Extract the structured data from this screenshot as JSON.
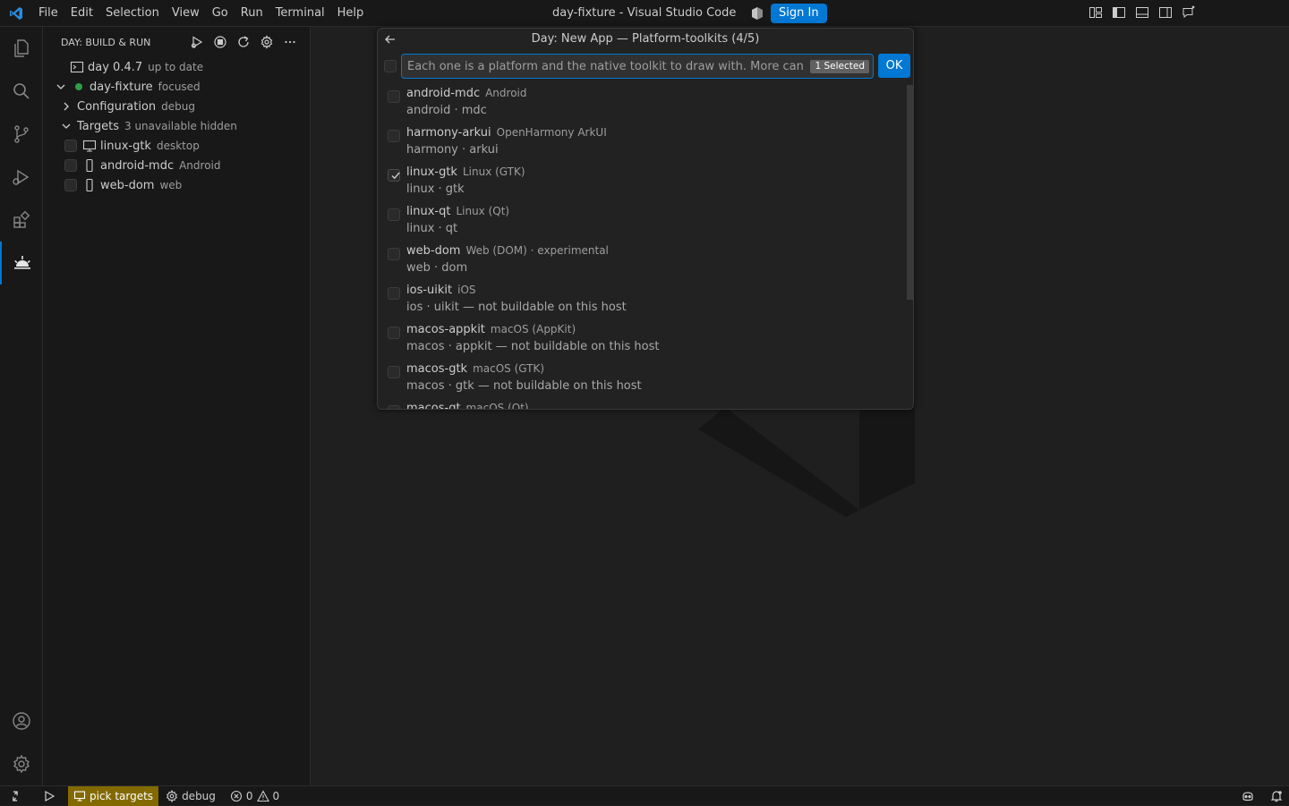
{
  "titlebar": {
    "menus": [
      "File",
      "Edit",
      "Selection",
      "View",
      "Go",
      "Run",
      "Terminal",
      "Help"
    ],
    "window_title": "day-fixture - Visual Studio Code",
    "sign_in_label": "Sign In"
  },
  "activitybar": {
    "items": [
      "explorer-icon",
      "search-icon",
      "source-control-icon",
      "run-debug-icon",
      "extensions-icon",
      "day-icon"
    ],
    "bottom": [
      "account-icon",
      "manage-gear-icon"
    ],
    "active": "day-icon"
  },
  "sidebar": {
    "title": "DAY: BUILD & RUN",
    "toolchain": {
      "label": "day 0.4.7",
      "desc": "up to date"
    },
    "project": {
      "label": "day-fixture",
      "desc": "focused"
    },
    "configuration": {
      "label": "Configuration",
      "desc": "debug"
    },
    "targets": {
      "label": "Targets",
      "desc": "3 unavailable hidden"
    },
    "target_items": [
      {
        "label": "linux-gtk",
        "desc": "desktop",
        "icon": "desktop-icon"
      },
      {
        "label": "android-mdc",
        "desc": "Android",
        "icon": "phone-icon"
      },
      {
        "label": "web-dom",
        "desc": "web",
        "icon": "phone-icon"
      }
    ]
  },
  "quickpick": {
    "title": "Day: New App — Platform-toolkits (4/5)",
    "placeholder": "Each one is a platform and the native toolkit to draw with. More can",
    "selected_count": "1 Selected",
    "ok_label": "OK",
    "items": [
      {
        "label": "android-mdc",
        "desc": "Android",
        "detail": "android · mdc",
        "checked": false
      },
      {
        "label": "harmony-arkui",
        "desc": "OpenHarmony ArkUI",
        "detail": "harmony · arkui",
        "checked": false
      },
      {
        "label": "linux-gtk",
        "desc": "Linux (GTK)",
        "detail": "linux · gtk",
        "checked": true
      },
      {
        "label": "linux-qt",
        "desc": "Linux (Qt)",
        "detail": "linux · qt",
        "checked": false
      },
      {
        "label": "web-dom",
        "desc": "Web (DOM) · experimental",
        "detail": "web · dom",
        "checked": false
      },
      {
        "label": "ios-uikit",
        "desc": "iOS",
        "detail": "ios · uikit — not buildable on this host",
        "checked": false
      },
      {
        "label": "macos-appkit",
        "desc": "macOS (AppKit)",
        "detail": "macos · appkit — not buildable on this host",
        "checked": false
      },
      {
        "label": "macos-gtk",
        "desc": "macOS (GTK)",
        "detail": "macos · gtk — not buildable on this host",
        "checked": false
      },
      {
        "label": "macos-qt",
        "desc": "macOS (Qt)",
        "detail": "",
        "checked": false
      }
    ]
  },
  "statusbar": {
    "pick_targets": "pick targets",
    "config": "debug",
    "errors": "0",
    "warnings": "0"
  },
  "colors": {
    "accent": "#0078d4",
    "status_warning_bg": "#826a00",
    "running_dot": "#2ea043"
  }
}
